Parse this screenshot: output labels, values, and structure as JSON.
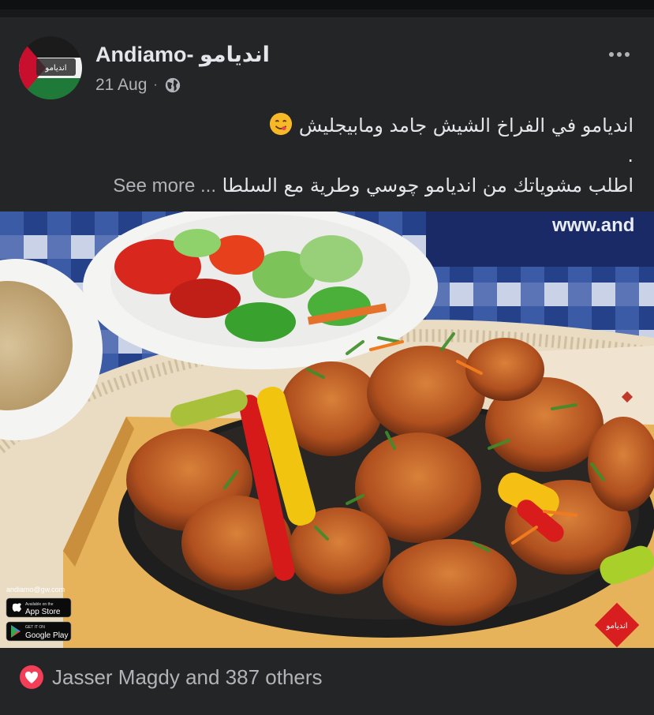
{
  "post": {
    "page_name": "Andiamo- اندیامو",
    "date": "21 Aug",
    "separator": "·",
    "privacy_icon": "globe-icon",
    "more_icon": "more-horizontal-icon",
    "text_lines": [
      "انديامو في الفراخ الشيش جامد ومابيجليش",
      ".",
      "اطلب مشوياتك من انديامو چوسي وطرية مع السلطا"
    ],
    "emoji": "smiling-face-icon",
    "see_more": "... See more",
    "avatar_label": "اندیامو"
  },
  "photo": {
    "watermark_url": "www.and",
    "store_site": "andiamo@gw.com",
    "app_store_small": "Available on the",
    "app_store_label": "App Store",
    "google_play_small": "GET IT ON",
    "google_play_label": "Google Play",
    "brand_badge": "اندیامو"
  },
  "reactions": {
    "icon": "love-reaction-icon",
    "text": "Jasser Magdy and 387 others"
  },
  "colors": {
    "background": "#18191a",
    "card": "#242526",
    "text_primary": "#e4e6eb",
    "text_secondary": "#b0b3b8",
    "love": "#f33e58"
  }
}
